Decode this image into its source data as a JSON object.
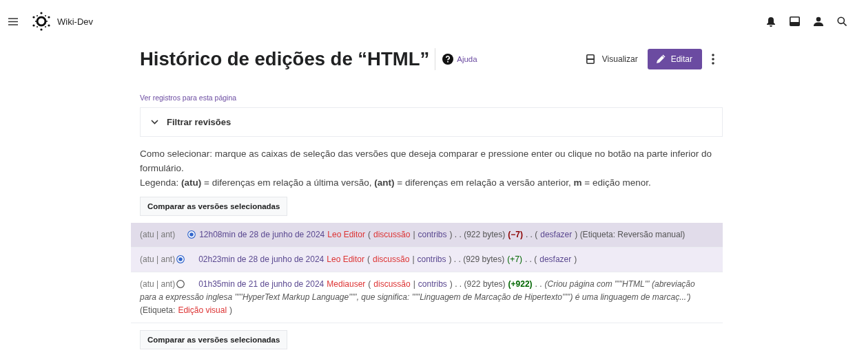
{
  "header": {
    "site_name": "Wiki-Dev"
  },
  "page": {
    "title": "Histórico de edições de “HTML”",
    "help": "Ajuda",
    "view": "Visualizar",
    "edit": "Editar",
    "logs_link": "Ver registros para esta página",
    "filter": {
      "label": "Filtrar revisões",
      "expanded": false
    }
  },
  "instructions": [
    "Como selecionar: marque as caixas de seleção das versões que deseja comparar e pressione enter ou clique no botão na parte inferior do formulário.",
    "Legenda: **(atu)** = diferenças em relação a última versão, **(ant)** = diferenças em relação a versão anterior, **m** = edição menor."
  ],
  "compare_buttons": [
    "Comparar as versões selecionadas",
    "Comparar as versões selecionadas"
  ],
  "rows": [
    {
      "selected": true,
      "hover": true,
      "segments": [
        {
          "kind": "muted",
          "text": "(atu | ant)"
        },
        {
          "kind": "radio_new",
          "selected": true
        },
        {
          "kind": "date",
          "text": "12h08min de 28 de junho de 2024"
        },
        {
          "kind": "user",
          "text": "Leo Editor"
        },
        {
          "kind": "plain",
          "text": "("
        },
        {
          "kind": "user",
          "text": "discussão"
        },
        {
          "kind": "plain",
          "text": "|"
        },
        {
          "kind": "link",
          "text": "contribs"
        },
        {
          "kind": "plain",
          "text": ") . . (922 bytes)"
        },
        {
          "kind": "minus",
          "text": "(−7)"
        },
        {
          "kind": "plain",
          "text": ". . ("
        },
        {
          "kind": "link",
          "text": "desfazer"
        },
        {
          "kind": "plain",
          "text": ") (Etiqueta: Reversão manual)"
        }
      ]
    },
    {
      "selected": true,
      "hover": false,
      "segments": [
        {
          "kind": "muted",
          "text": "(atu | ant)"
        },
        {
          "kind": "radio_old",
          "selected": true
        },
        {
          "kind": "date",
          "text": "02h23min de 28 de junho de 2024"
        },
        {
          "kind": "user",
          "text": "Leo Editor"
        },
        {
          "kind": "plain",
          "text": "("
        },
        {
          "kind": "user",
          "text": "discussão"
        },
        {
          "kind": "plain",
          "text": "|"
        },
        {
          "kind": "link",
          "text": "contribs"
        },
        {
          "kind": "plain",
          "text": ") . . (929 bytes)"
        },
        {
          "kind": "plus",
          "text": "(+7)"
        },
        {
          "kind": "plain",
          "text": ". . ("
        },
        {
          "kind": "link",
          "text": "desfazer"
        },
        {
          "kind": "plain",
          "text": ")"
        }
      ]
    },
    {
      "selected": false,
      "hover": false,
      "segments": [
        {
          "kind": "muted",
          "text": "(atu | ant)"
        },
        {
          "kind": "radio_old",
          "selected": false
        },
        {
          "kind": "date",
          "text": "01h35min de 21 de junho de 2024"
        },
        {
          "kind": "user",
          "text": "Mediauser"
        },
        {
          "kind": "plain",
          "text": "("
        },
        {
          "kind": "user",
          "text": "discussão"
        },
        {
          "kind": "plain",
          "text": "|"
        },
        {
          "kind": "link",
          "text": "contribs"
        },
        {
          "kind": "plain",
          "text": ") . . (922 bytes)"
        },
        {
          "kind": "bigplus",
          "text": "(+922)"
        },
        {
          "kind": "plain",
          "text": ". ."
        },
        {
          "kind": "comment",
          "text": "(Criou página com \"'''HTML''' (abreviação"
        },
        {
          "kind": "break"
        },
        {
          "kind": "comment",
          "text": "para a expressão inglesa '''''HyperText Markup Language''''', que significa: '''''Linguagem de Marcação de Hipertexto''''') é uma linguagem de marcaç...')"
        },
        {
          "kind": "break"
        },
        {
          "kind": "plain",
          "text": "(Etiqueta:"
        },
        {
          "kind": "user",
          "text": "Edição visual"
        },
        {
          "kind": "plain",
          "text": ")"
        }
      ]
    }
  ]
}
